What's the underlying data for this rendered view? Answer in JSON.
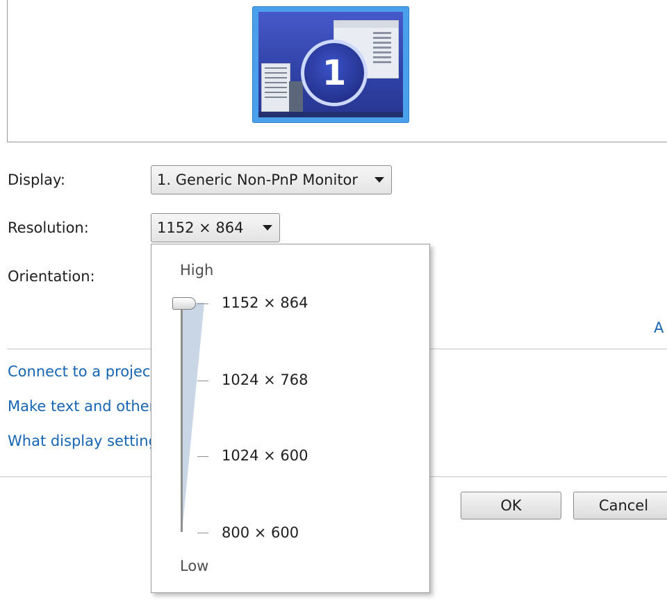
{
  "preview": {
    "monitor_number": "1"
  },
  "form": {
    "display_label": "Display:",
    "display_value": "1. Generic Non-PnP Monitor",
    "resolution_label": "Resolution:",
    "resolution_value": "1152 × 864",
    "orientation_label": "Orientation:"
  },
  "resolution_dropdown": {
    "high_label": "High",
    "low_label": "Low",
    "options": [
      "1152 × 864",
      "1024 × 768",
      "1024 × 600",
      "800 × 600"
    ],
    "selected_index": 0
  },
  "advanced_link_partial": "A",
  "links": [
    "Connect to a projec",
    "Make text and other",
    "What display setting"
  ],
  "buttons": {
    "ok": "OK",
    "cancel": "Cancel"
  }
}
